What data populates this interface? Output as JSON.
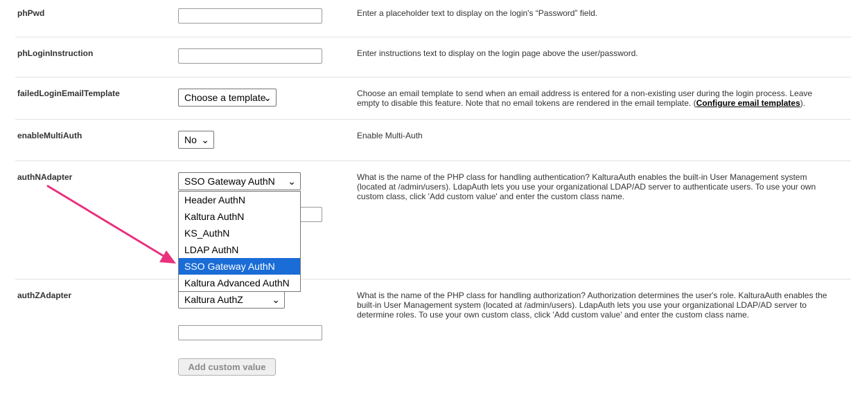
{
  "rows": {
    "phPwd": {
      "label": "phPwd",
      "description": "Enter a placeholder text to display on the login's “Password” field."
    },
    "phLoginInstruction": {
      "label": "phLoginInstruction",
      "description": "Enter instructions text to display on the login page above the user/password."
    },
    "failedLoginEmailTemplate": {
      "label": "failedLoginEmailTemplate",
      "select_value": "Choose a template",
      "description_pre": "Choose an email template to send when an email address is entered for a non-existing user during the login process. Leave empty to disable this feature. Note that no email tokens are rendered in the email template. (",
      "description_link": "Configure email templates",
      "description_post": ")."
    },
    "enableMultiAuth": {
      "label": "enableMultiAuth",
      "select_value": "No",
      "description": "Enable Multi-Auth"
    },
    "authNAdapter": {
      "label": "authNAdapter",
      "select_value": "SSO Gateway AuthN",
      "description": "What is the name of the PHP class for handling authentication? KalturaAuth enables the built-in User Management system (located at /admin/users). LdapAuth lets you use your organizational LDAP/AD server to authenticate users. To use your own custom class, click 'Add custom value' and enter the custom class name.",
      "options": [
        "Header AuthN",
        "Kaltura AuthN",
        "KS_AuthN",
        "LDAP AuthN",
        "SSO Gateway AuthN",
        "Kaltura Advanced AuthN"
      ],
      "selected_option": "SSO Gateway AuthN"
    },
    "authZAdapter": {
      "label": "authZAdapter",
      "select_value": "Kaltura AuthZ",
      "description": "What is the name of the PHP class for handling authorization? Authorization determines the user's role. KalturaAuth enables the built-in User Management system (located at /admin/users). LdapAuth lets you use your organizational LDAP/AD server to determine roles. To use your own custom class, click 'Add custom value' and enter the custom class name.",
      "add_button": "Add custom value"
    }
  },
  "colors": {
    "arrow": "#e8327c",
    "selected_option_bg": "#1a6cd6"
  }
}
